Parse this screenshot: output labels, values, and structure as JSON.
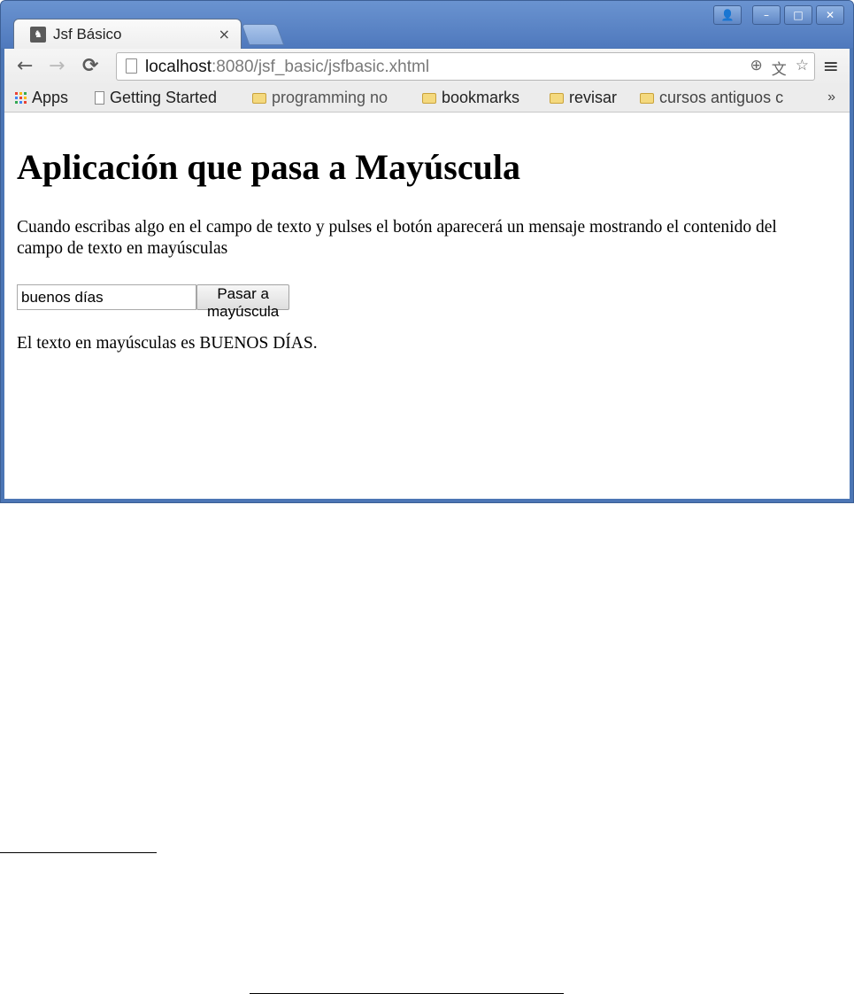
{
  "browser": {
    "tab": {
      "title": "Jsf Básico",
      "close": "×"
    },
    "window_buttons": {
      "user": "👤",
      "minimize": "–",
      "maximize": "□",
      "close": "✕"
    },
    "nav": {
      "back": "←",
      "forward": "→",
      "reload": "C"
    },
    "address": {
      "host": "localhost",
      "rest": ":8080/jsf_basic/jsfbasic.xhtml"
    },
    "omni_icons": {
      "zoom": "⊕",
      "translate": "文",
      "star": "☆"
    },
    "menu": "≡",
    "bookmarks": [
      {
        "label": "Apps",
        "icon": "apps-grid-icon"
      },
      {
        "label": "Getting Started",
        "icon": "page-icon"
      },
      {
        "label": "programming no",
        "icon": "folder-icon"
      },
      {
        "label": "bookmarks",
        "icon": "folder-icon"
      },
      {
        "label": "revisar",
        "icon": "folder-icon"
      },
      {
        "label": "cursos antiguos c",
        "icon": "folder-icon"
      }
    ],
    "bookmarks_overflow": "»"
  },
  "page": {
    "heading": "Aplicación que pasa a Mayúscula",
    "description": "Cuando escribas algo en el campo de texto y pulses el botón aparecerá un mensaje mostrando el contenido del campo de texto en mayúsculas",
    "input_value": "buenos días",
    "button_label": "Pasar a mayúscula",
    "result": "El texto en mayúsculas es BUENOS DÍAS."
  },
  "colors": {
    "titlebar": "#4c76b5",
    "apps_grid": [
      "#e94235",
      "#fbbc05",
      "#34a853",
      "#4285f4",
      "#e94235",
      "#fbbc05",
      "#34a853",
      "#4285f4",
      "#e94235"
    ]
  }
}
